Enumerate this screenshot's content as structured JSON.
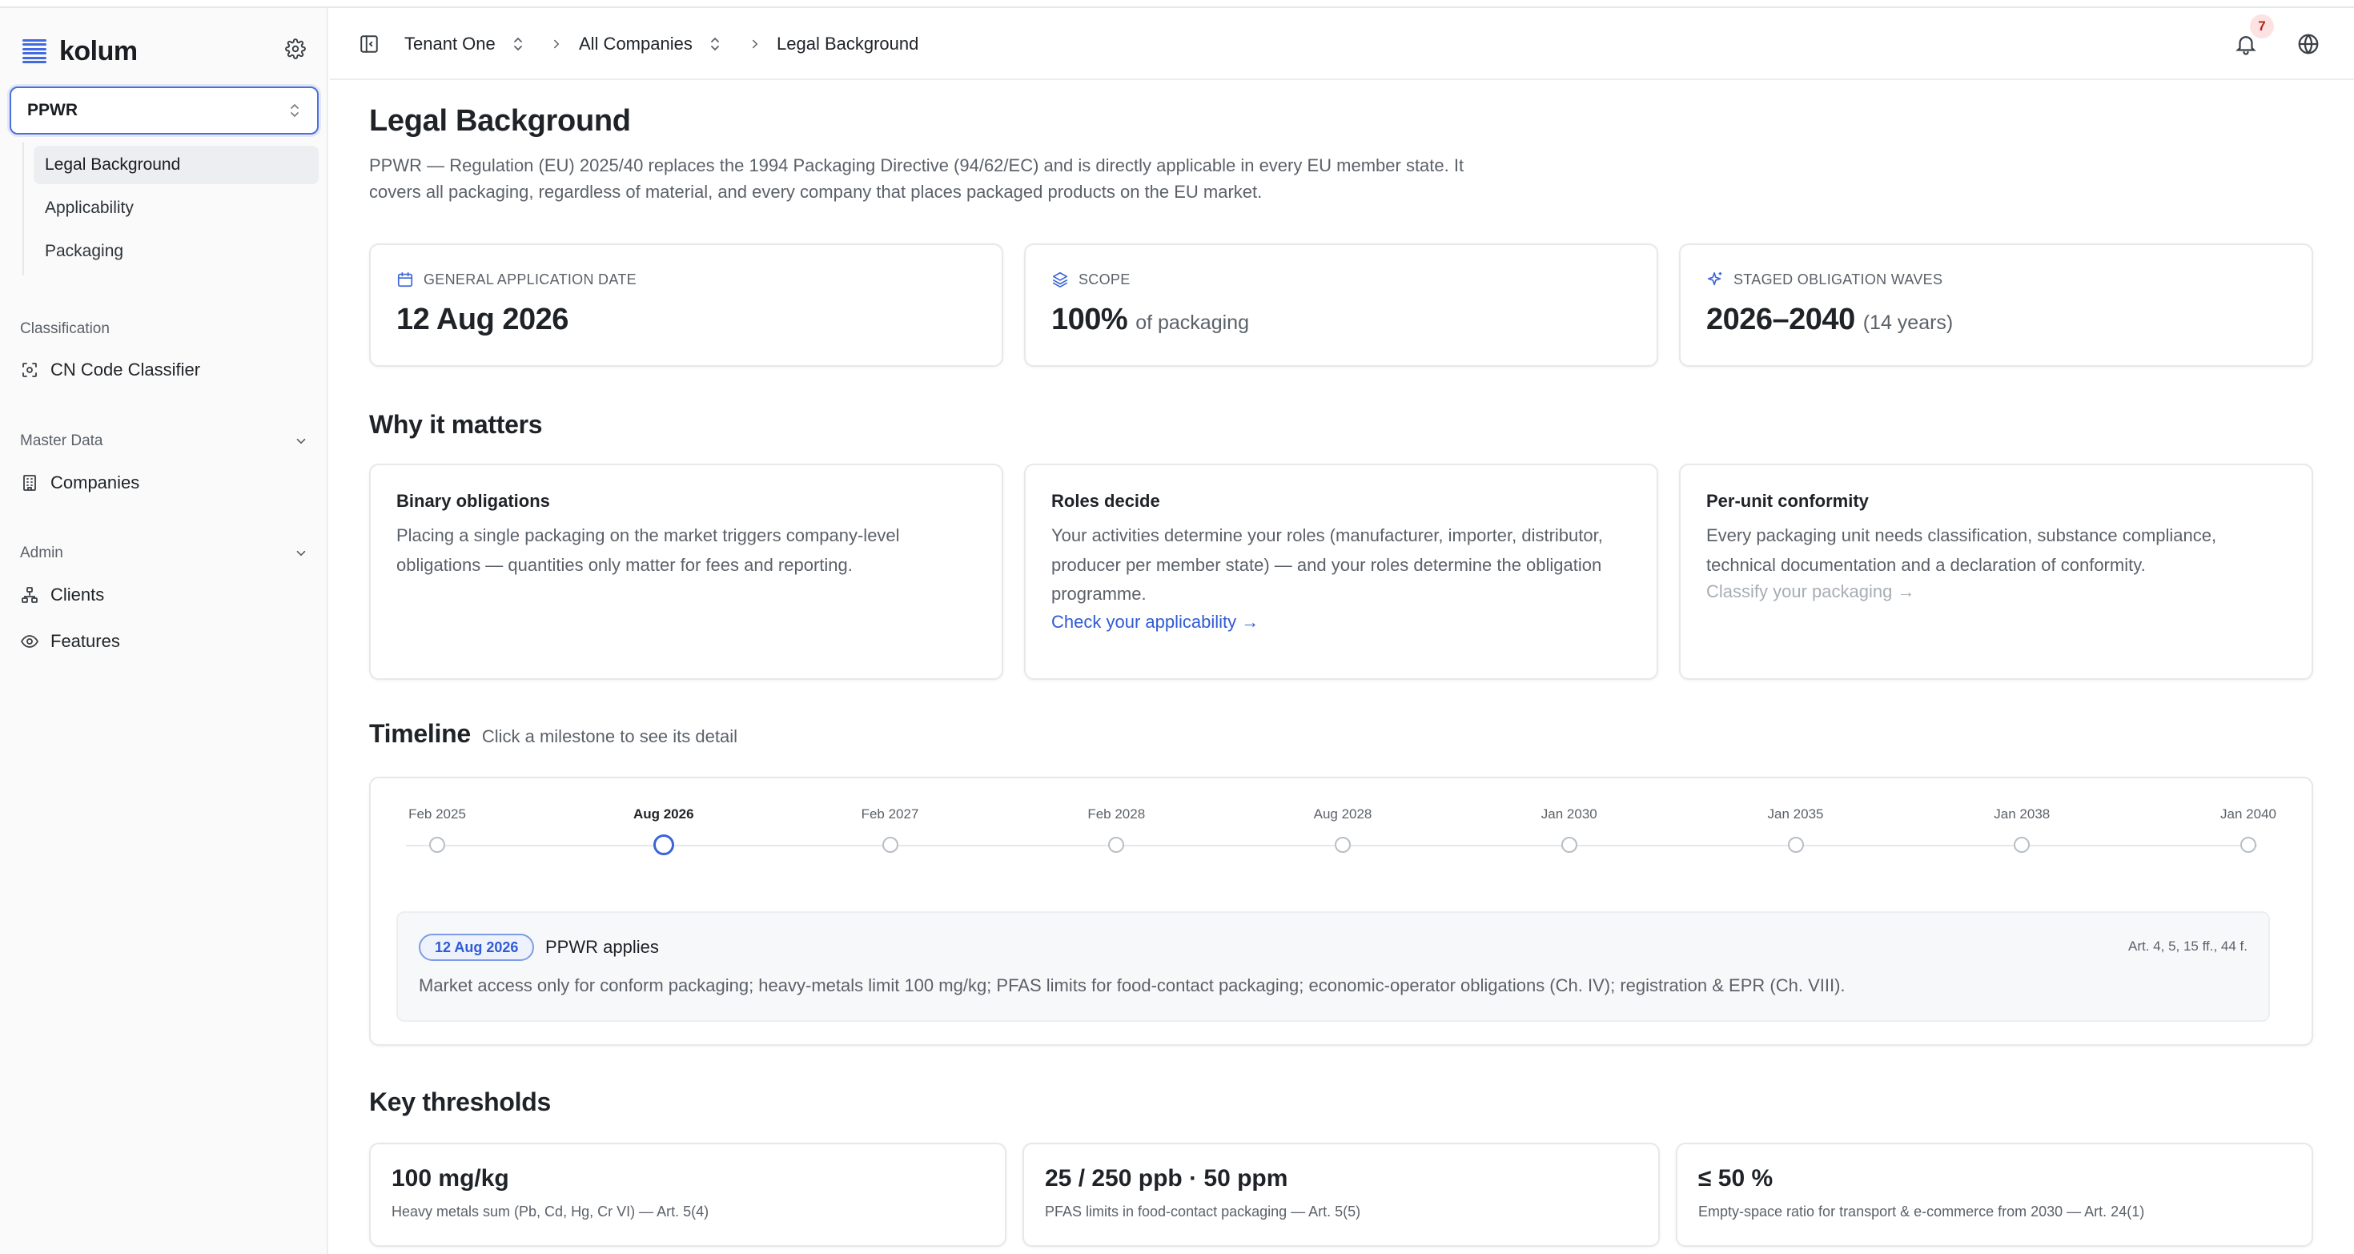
{
  "app": {
    "name": "kolum"
  },
  "sidebar": {
    "regulation": "PPWR",
    "subnav": [
      {
        "label": "Legal Background",
        "active": true
      },
      {
        "label": "Applicability",
        "active": false
      },
      {
        "label": "Packaging",
        "active": false
      }
    ],
    "groups": {
      "classification": {
        "label": "Classification",
        "items": [
          {
            "label": "CN Code Classifier",
            "icon": "scan-icon"
          }
        ]
      },
      "master_data": {
        "label": "Master Data",
        "items": [
          {
            "label": "Companies",
            "icon": "building-icon"
          }
        ]
      },
      "admin": {
        "label": "Admin",
        "items": [
          {
            "label": "Clients",
            "icon": "network-icon"
          },
          {
            "label": "Features",
            "icon": "eye-icon"
          }
        ]
      }
    }
  },
  "header": {
    "breadcrumbs": [
      "Tenant One",
      "All Companies",
      "Legal Background"
    ],
    "notifications": "7"
  },
  "page": {
    "title": "Legal Background",
    "intro_line1": "PPWR — Regulation (EU) 2025/40 replaces the 1994 Packaging Directive (94/62/EC) and is directly applicable in every EU member state. It",
    "intro_line2": "covers all packaging, regardless of material, and every company that places packaged products on the EU market."
  },
  "stats": [
    {
      "label": "GENERAL APPLICATION DATE",
      "value": "12 Aug 2026",
      "sub": "",
      "icon": "calendar-icon"
    },
    {
      "label": "SCOPE",
      "value": "100%",
      "sub": "of packaging",
      "icon": "layers-icon"
    },
    {
      "label": "STAGED OBLIGATION WAVES",
      "value": "2026–2040",
      "sub": "(14 years)",
      "icon": "sparkle-icon"
    }
  ],
  "why": {
    "title": "Why it matters",
    "cards": [
      {
        "title": "Binary obligations",
        "lines": [
          "Placing a single packaging on the market triggers company-level",
          "obligations — quantities only matter for fees and reporting."
        ],
        "link": ""
      },
      {
        "title": "Roles decide",
        "lines": [
          "Your activities determine your roles (manufacturer, importer, distributor,",
          "producer per member state) — and your roles determine the obligation",
          "programme."
        ],
        "link": "Check your applicability →"
      },
      {
        "title": "Per-unit conformity",
        "lines": [
          "Every packaging unit needs classification, substance compliance,",
          "technical documentation and a declaration of conformity."
        ],
        "link": "Classify your packaging →"
      }
    ]
  },
  "timeline": {
    "title": "Timeline",
    "hint": "Click a milestone to see its detail",
    "milestones": [
      "Feb 2025",
      "Aug 2026",
      "Feb 2027",
      "Feb 2028",
      "Aug 2028",
      "Jan 2030",
      "Jan 2035",
      "Jan 2038",
      "Jan 2040"
    ],
    "active_index": 1,
    "detail": {
      "date": "12 Aug 2026",
      "title": "PPWR applies",
      "ref": "Art. 4, 5, 15 ff., 44 f.",
      "body": "Market access only for conform packaging; heavy-metals limit 100 mg/kg; PFAS limits for food-contact packaging; economic-operator obligations (Ch. IV); registration & EPR (Ch. VIII)."
    }
  },
  "thresholds": {
    "title": "Key thresholds",
    "items": [
      {
        "value": "100 mg/kg",
        "desc": "Heavy metals sum (Pb, Cd, Hg, Cr VI) — Art. 5(4)"
      },
      {
        "value": "25 / 250 ppb · 50 ppm",
        "desc": "PFAS limits in food-contact packaging — Art. 5(5)"
      },
      {
        "value": "≤ 50 %",
        "desc": "Empty-space ratio for transport & e-commerce from 2030 — Art. 24(1)"
      }
    ]
  },
  "colors": {
    "accent": "#2f5bd3",
    "badge_bg": "#fde2e2"
  }
}
